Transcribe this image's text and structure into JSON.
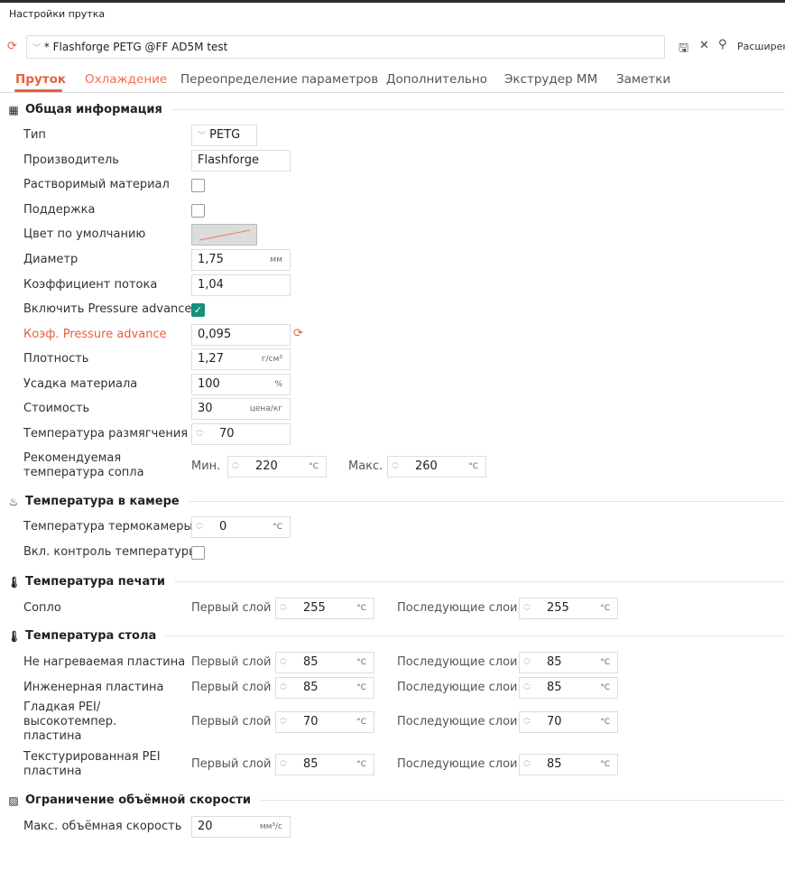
{
  "window": {
    "title": "Настройки прутка"
  },
  "toolbar": {
    "preset": "* Flashforge PETG @FF AD5M test",
    "advanced_label": "Расширен"
  },
  "tabs": [
    "Пруток",
    "Охлаждение",
    "Переопределение параметров",
    "Дополнительно",
    "Экструдер ММ",
    "Заметки"
  ],
  "colors": {
    "accent": "#e8603c",
    "checkbox_on": "#16917d"
  },
  "general": {
    "title": "Общая информация",
    "type_label": "Тип",
    "type_value": "PETG",
    "vendor_label": "Производитель",
    "vendor_value": "Flashforge",
    "soluble_label": "Растворимый материал",
    "soluble_checked": false,
    "support_label": "Поддержка",
    "support_checked": false,
    "color_label": "Цвет по умолчанию",
    "diameter_label": "Диаметр",
    "diameter_value": "1,75",
    "diameter_unit": "мм",
    "flow_label": "Коэффициент потока",
    "flow_value": "1,04",
    "pa_enable_label": "Включить Pressure advance",
    "pa_enable_checked": true,
    "pa_label": "Коэф. Pressure advance",
    "pa_value": "0,095",
    "density_label": "Плотность",
    "density_value": "1,27",
    "density_unit": "г/см³",
    "shrink_label": "Усадка материала",
    "shrink_value": "100",
    "shrink_unit": "%",
    "cost_label": "Стоимость",
    "cost_value": "30",
    "cost_unit": "цена/кг",
    "soften_label": "Температура размягчения",
    "soften_value": "70",
    "nozzle_range_label": "Рекомендуемая температура сопла",
    "min_label": "Мин.",
    "min_value": "220",
    "max_label": "Макс.",
    "max_value": "260",
    "deg": "°C"
  },
  "chamber": {
    "title": "Температура в камере",
    "temp_label": "Температура термокамеры",
    "temp_value": "0",
    "control_label": "Вкл. контроль температуры",
    "control_checked": false
  },
  "print_temp": {
    "title": "Температура печати",
    "first": "Первый слой",
    "other": "Последующие слои",
    "nozzle_label": "Сопло",
    "nozzle_first": "255",
    "nozzle_other": "255"
  },
  "bed": {
    "title": "Температура стола",
    "rows": [
      {
        "label": "Не нагреваемая пластина",
        "first": "85",
        "other": "85"
      },
      {
        "label": "Инженерная пластина",
        "first": "85",
        "other": "85"
      },
      {
        "label": "Гладкая PEI/высокотемпер. пластина",
        "first": "70",
        "other": "70"
      },
      {
        "label": "Текстурированная PEI пластина",
        "first": "85",
        "other": "85"
      }
    ]
  },
  "volumetric": {
    "title": "Ограничение объёмной скорости",
    "label": "Макс. объёмная скорость",
    "value": "20",
    "unit": "мм³/с"
  }
}
